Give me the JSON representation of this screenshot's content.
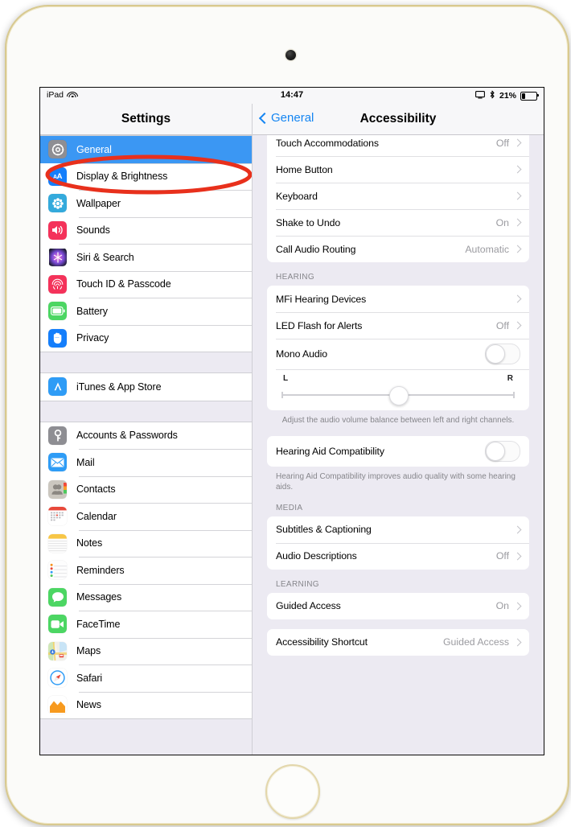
{
  "device": {
    "name": "iPad",
    "body_color": "#fbfbf9",
    "bezel_color": "#d8c98f"
  },
  "status_bar": {
    "carrier": "iPad",
    "wifi_icon": "wifi-icon",
    "time": "14:47",
    "screen_mirror_icon": "screen-mirroring-icon",
    "bluetooth_icon": "bluetooth-icon",
    "battery_percent": "21%",
    "battery_icon": "battery-icon",
    "battery_level": 21
  },
  "sidebar": {
    "title": "Settings",
    "selected_item": "General",
    "selected_color": "#3b97f3",
    "groups": [
      {
        "items": [
          {
            "label": "General",
            "icon": "gear-icon",
            "icon_color": "#8e8e93",
            "selected": true
          },
          {
            "label": "Display & Brightness",
            "icon": "text-size-icon",
            "icon_color": "#147efb"
          },
          {
            "label": "Wallpaper",
            "icon": "wallpaper-icon",
            "icon_color": "#34aadc"
          },
          {
            "label": "Sounds",
            "icon": "speaker-icon",
            "icon_color": "#f4325a"
          },
          {
            "label": "Siri & Search",
            "icon": "siri-icon",
            "icon_color": "#2b2b3c"
          },
          {
            "label": "Touch ID & Passcode",
            "icon": "fingerprint-icon",
            "icon_color": "#f4325a"
          },
          {
            "label": "Battery",
            "icon": "battery-icon",
            "icon_color": "#4cd663"
          },
          {
            "label": "Privacy",
            "icon": "hand-icon",
            "icon_color": "#147efb"
          }
        ]
      },
      {
        "items": [
          {
            "label": "iTunes & App Store",
            "icon": "app-store-icon",
            "icon_color": "#2e9cf6"
          }
        ]
      },
      {
        "items": [
          {
            "label": "Accounts & Passwords",
            "icon": "key-icon",
            "icon_color": "#8e8e93"
          },
          {
            "label": "Mail",
            "icon": "mail-icon",
            "icon_color": "#2e9cf6"
          },
          {
            "label": "Contacts",
            "icon": "contacts-icon",
            "icon_color": "#c9c5bd"
          },
          {
            "label": "Calendar",
            "icon": "calendar-icon",
            "icon_color": "#ffffff"
          },
          {
            "label": "Notes",
            "icon": "notes-icon",
            "icon_color": "#ffffff"
          },
          {
            "label": "Reminders",
            "icon": "reminders-icon",
            "icon_color": "#ffffff"
          },
          {
            "label": "Messages",
            "icon": "messages-icon",
            "icon_color": "#4cd663"
          },
          {
            "label": "FaceTime",
            "icon": "facetime-icon",
            "icon_color": "#4cd663"
          },
          {
            "label": "Maps",
            "icon": "maps-icon",
            "icon_color": "#e8e8ec"
          },
          {
            "label": "Safari",
            "icon": "safari-icon",
            "icon_color": "#2e9cf6"
          },
          {
            "label": "News",
            "icon": "news-icon",
            "icon_color": "#f79a1f"
          }
        ]
      }
    ]
  },
  "detail": {
    "back_label": "General",
    "title": "Accessibility",
    "sections": [
      {
        "header": "",
        "rows": [
          {
            "label": "Touch Accommodations",
            "value": "Off",
            "accessory": "chevron"
          },
          {
            "label": "Home Button",
            "value": "",
            "accessory": "chevron"
          },
          {
            "label": "Keyboard",
            "value": "",
            "accessory": "chevron"
          },
          {
            "label": "Shake to Undo",
            "value": "On",
            "accessory": "chevron"
          },
          {
            "label": "Call Audio Routing",
            "value": "Automatic",
            "accessory": "chevron"
          }
        ],
        "footer": ""
      },
      {
        "header": "HEARING",
        "rows": [
          {
            "label": "MFi Hearing Devices",
            "value": "",
            "accessory": "chevron"
          },
          {
            "label": "LED Flash for Alerts",
            "value": "Off",
            "accessory": "chevron"
          },
          {
            "label": "Mono Audio",
            "value": "",
            "accessory": "toggle",
            "toggle_on": false
          }
        ],
        "slider": {
          "left_label": "L",
          "right_label": "R",
          "value": 50
        },
        "footer": "Adjust the audio volume balance between left and right channels."
      },
      {
        "header": "",
        "rows": [
          {
            "label": "Hearing Aid Compatibility",
            "value": "",
            "accessory": "toggle",
            "toggle_on": false
          }
        ],
        "footer": "Hearing Aid Compatibility improves audio quality with some hearing aids."
      },
      {
        "header": "MEDIA",
        "rows": [
          {
            "label": "Subtitles & Captioning",
            "value": "",
            "accessory": "chevron"
          },
          {
            "label": "Audio Descriptions",
            "value": "Off",
            "accessory": "chevron"
          }
        ],
        "footer": ""
      },
      {
        "header": "LEARNING",
        "rows": [
          {
            "label": "Guided Access",
            "value": "On",
            "accessory": "chevron"
          }
        ],
        "footer": ""
      },
      {
        "header": "",
        "rows": [
          {
            "label": "Accessibility Shortcut",
            "value": "Guided Access",
            "accessory": "chevron"
          }
        ],
        "footer": ""
      }
    ]
  },
  "annotation": {
    "shape": "ellipse",
    "color": "#e8301c",
    "target": "General"
  }
}
